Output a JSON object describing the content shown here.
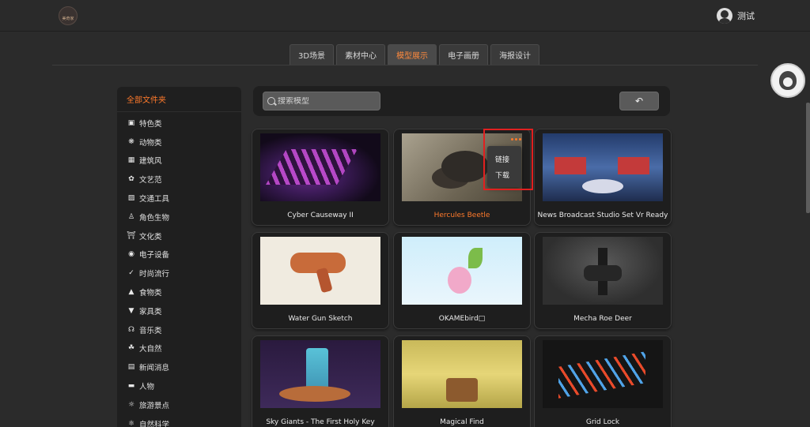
{
  "header": {
    "logo_text": "美奇家",
    "user_name": "测试"
  },
  "tabs": [
    {
      "label": "3D场景",
      "active": false
    },
    {
      "label": "素材中心",
      "active": false
    },
    {
      "label": "模型展示",
      "active": true
    },
    {
      "label": "电子画册",
      "active": false
    },
    {
      "label": "海报设计",
      "active": false
    }
  ],
  "sidebar": {
    "title": "全部文件夹",
    "items": [
      {
        "label": "特色类",
        "icon": "tv-icon"
      },
      {
        "label": "动物类",
        "icon": "bug-icon"
      },
      {
        "label": "建筑风",
        "icon": "building-icon"
      },
      {
        "label": "文艺范",
        "icon": "palette-icon"
      },
      {
        "label": "交通工具",
        "icon": "car-icon"
      },
      {
        "label": "角色生物",
        "icon": "person-icon"
      },
      {
        "label": "文化类",
        "icon": "museum-icon"
      },
      {
        "label": "电子设备",
        "icon": "chip-icon"
      },
      {
        "label": "时尚流行",
        "icon": "shoe-icon"
      },
      {
        "label": "食物类",
        "icon": "food-icon"
      },
      {
        "label": "家具类",
        "icon": "lamp-icon"
      },
      {
        "label": "音乐类",
        "icon": "headphones-icon"
      },
      {
        "label": "大自然",
        "icon": "nature-icon"
      },
      {
        "label": "新闻消息",
        "icon": "news-icon"
      },
      {
        "label": "人物",
        "icon": "glasses-icon"
      },
      {
        "label": "旅游景点",
        "icon": "compass-icon"
      },
      {
        "label": "自然科学",
        "icon": "atom-icon"
      }
    ]
  },
  "search": {
    "placeholder": "搜索模型",
    "value": ""
  },
  "back_button": {
    "icon": "return-icon"
  },
  "models": [
    {
      "title": "Cyber Causeway II",
      "thumb": "t1"
    },
    {
      "title": "Hercules Beetle",
      "thumb": "t2"
    },
    {
      "title": "News Broadcast Studio Set Vr Ready",
      "thumb": "t3"
    },
    {
      "title": "Water Gun Sketch",
      "thumb": "t4"
    },
    {
      "title": "OKAMEbird□",
      "thumb": "t5"
    },
    {
      "title": "Mecha Roe Deer",
      "thumb": "t6"
    },
    {
      "title": "Sky Giants - The First Holy Key",
      "thumb": "t7"
    },
    {
      "title": "Magical Find",
      "thumb": "t8"
    },
    {
      "title": "Grid Lock",
      "thumb": "t9"
    }
  ],
  "context_menu": {
    "items": [
      "链接",
      "下载"
    ]
  },
  "colors": {
    "accent": "#ff7a2b",
    "background": "#2b2b2b",
    "panel": "#1f1f1f",
    "highlight_box": "#e02020"
  }
}
